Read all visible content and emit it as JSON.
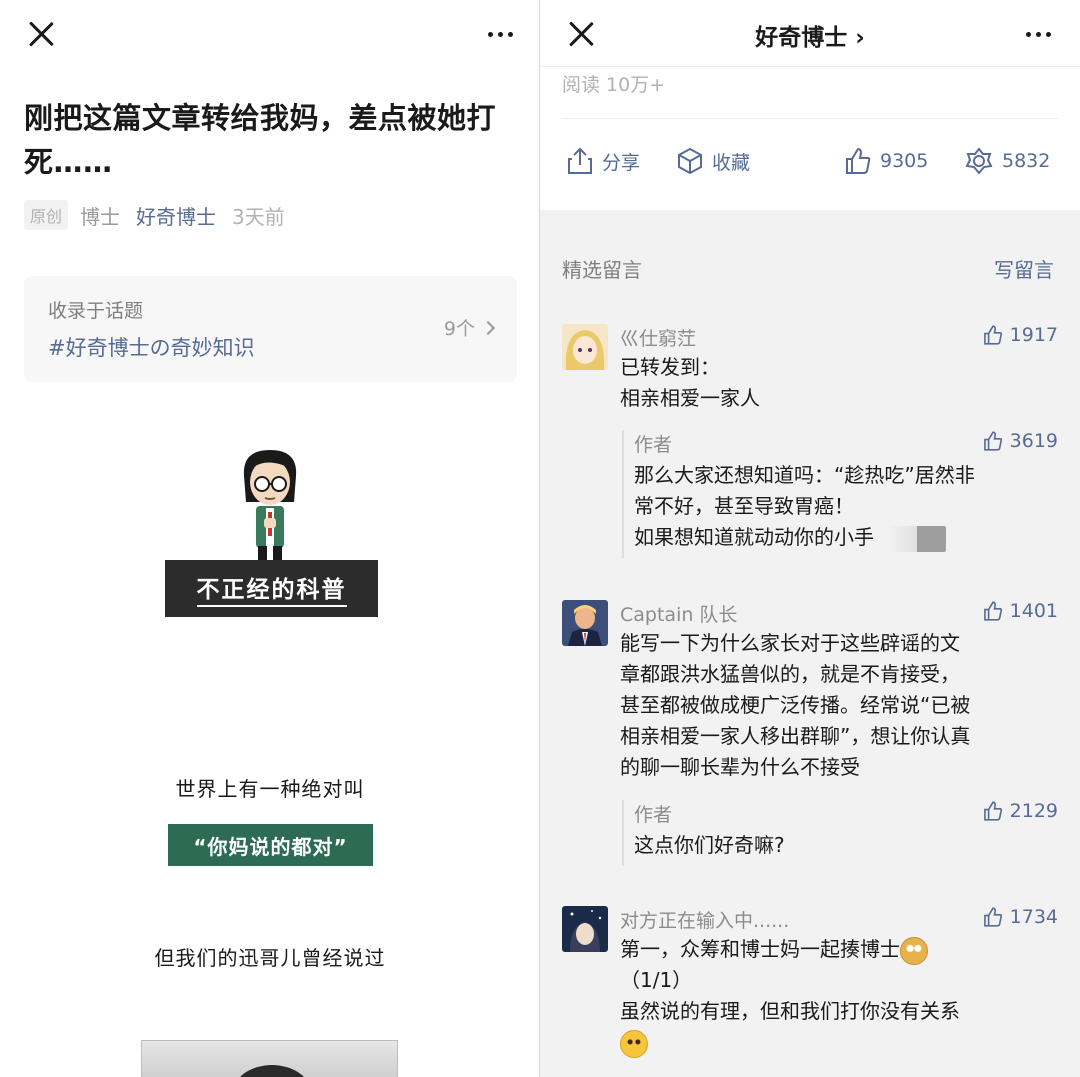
{
  "left": {
    "title": "刚把这篇文章转给我妈，差点被她打死……",
    "meta": {
      "badge": "原创",
      "author": "博士",
      "account": "好奇博士",
      "time": "3天前"
    },
    "topic": {
      "label": "收录于话题",
      "tag": "#好奇博士の奇妙知识",
      "count": "9个"
    },
    "banner_text": "不正经的科普",
    "line1": "世界上有一种绝对叫",
    "green_box": "“你妈说的都对”",
    "line2": "但我们的迅哥儿曾经说过"
  },
  "right": {
    "header_title": "好奇博士 ›",
    "read_count": "阅读 10万+",
    "actions": {
      "share": "分享",
      "favorite": "收藏",
      "like_count": "9305",
      "wow_count": "5832"
    },
    "comments_title": "精选留言",
    "write_comment": "写留言",
    "comments": [
      {
        "name": "巛仕窮茳",
        "likes": "1917",
        "lines": [
          "已转发到：",
          "相亲相爱一家人"
        ],
        "reply": {
          "name": "作者",
          "likes": "3619",
          "lines": [
            "那么大家还想知道吗：“趁热吃”居然非",
            "常不好，甚至导致胃癌！",
            "如果想知道就动动你的小手"
          ]
        }
      },
      {
        "name": "Captain 队长",
        "likes": "1401",
        "lines": [
          "能写一下为什么家长对于这些辟谣的文",
          "章都跟洪水猛兽似的，就是不肯接受，",
          "甚至都被做成梗广泛传播。经常说“已被",
          "相亲相爱一家人移出群聊”，想让你认真",
          "的聊一聊长辈为什么不接受"
        ],
        "reply": {
          "name": "作者",
          "likes": "2129",
          "lines": [
            "这点你们好奇嘛?"
          ]
        }
      },
      {
        "name": "对方正在输入中......",
        "likes": "1734",
        "lines": [
          "第一，众筹和博士妈一起揍博士",
          "（1/1）",
          "虽然说的有理，但和我们打你没有关系"
        ]
      }
    ]
  },
  "colors": {
    "link_blue": "#576b95",
    "green_box": "#2d6b55",
    "banner_dark": "#2c2c2c",
    "comments_bg": "#f2f2f2"
  }
}
